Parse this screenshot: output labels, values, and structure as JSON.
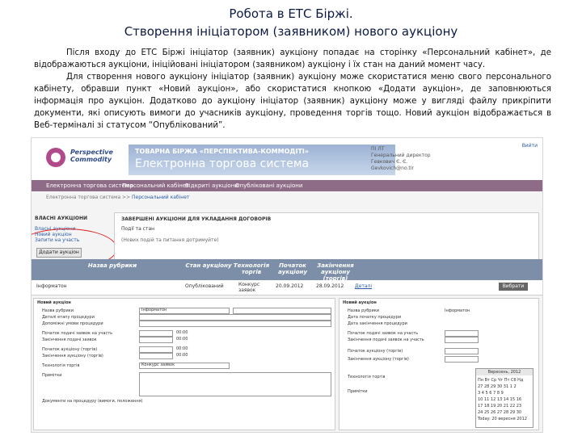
{
  "slide": {
    "title_line1": "Робота в ЕТС Біржі.",
    "title_line2": "Створення ініціатором (заявником) нового аукціону",
    "paragraph1": "Після входу до ЕТС Біржі ініціатор (заявник) аукціону попадає на сторінку «Персональний кабінет», де відображаються аукціони, ініційовані ініціатором (заявником) аукціону і їх стан на даний момент часу.",
    "paragraph2": "Для створення нового аукціону ініціатор (заявник) аукціону може скористатися меню свого персонального кабінету, обравши пункт «Новий аукціон», або скористатися кнопкою «Додати аукціон», де заповнюються інформація про аукціон. Додатково до аукціону ініціатор (заявник) аукціону може у вигляді файлу прикріпити документи, які описують вимоги до учасників аукціону, проведення торгів тощо. Новий аукціон відображається в Веб-терміналі зі статусом “Опублікований”."
  },
  "screenshot": {
    "logo_line1": "Perspective",
    "logo_line2": "Commodity",
    "banner_line1": "ТОВАРНА БІРЖА «ПЕРСПЕКТИВА-КОММОДІТІ»",
    "banner_line2": "Електронна торгова система",
    "user_line1": "ПІ      ЛТ",
    "user_line2": "Генеральний директор",
    "user_line3": "Гевкович Є. Є.",
    "user_line4": "Gevkovich@no.tir",
    "login": "Вийти",
    "nav": [
      "Електронна торгова система",
      "Персональний кабінет",
      "Відкриті аукціони",
      "Опубліковані аукціони"
    ],
    "crumb_a": "Електронна торгова система >> ",
    "crumb_b": "Персональний кабінет",
    "side_heading": "ВЛАСНІ АУКЦІОНИ",
    "side_items": [
      "Власні аукціони",
      "Новий аукціон",
      "Запити на участь"
    ],
    "add_button": "Додати аукціон",
    "panel_heading": "ЗАВЕРШЕНІ АУКЦІОНИ ДЛЯ УКЛАДАННЯ ДОГОВОРІВ",
    "panel_filter": "Події та стан",
    "panel_status": "(Нових подій та питання дотримуйте)",
    "table_headers": [
      "Назва рубрики",
      "Стан аукціону",
      "Технологія торгів",
      "Початок аукціону",
      "Закінчення аукціону (торгів)"
    ],
    "row": {
      "name": "Інформатон",
      "state": "Опублікований",
      "tech": "Конкурс заявок",
      "start": "20.09.2012",
      "end": "28.09.2012",
      "details": "Деталі",
      "view": "Вибрати"
    },
    "form_labels": [
      "Новий аукціон",
      "Назва рубрики",
      "Деталі етапу процедури",
      "Допоміжні умови процедури",
      "Початок подачі заявок на участь",
      "Закінчення подачі заявок",
      "Початок аукціону (торгів)",
      "Закінчення аукціону (торгів)",
      "Технологія торгів",
      "Примітки",
      "Документи на процедуру (вимоги, положення)"
    ],
    "form_value": "Інформатон",
    "form_tech": "Конкурс заявок",
    "time_value": "00:00",
    "right_labels": [
      "Новий аукціон",
      "Назва рубрики",
      "Дата початку процедури",
      "Дата закінчення процедури",
      "Початок подачі заявок на участь",
      "Закінчення подачі заявок на участь",
      "Початок аукціону (торгів)",
      "Закінчення аукціону (торгів)",
      "Технологія торгів",
      "Примітки"
    ],
    "right_value": "Інформатон",
    "calendar_title": "Вересень, 2012",
    "calendar_rows": [
      "Пн Вт Ср Чт Пт Сб Нд",
      "27 28 29 30 31 1 2",
      "3 4 5 6 7 8 9",
      "10 11 12 13 14 15 16",
      "17 18 19 20 21 22 23",
      "24 25 26 27 28 29 30"
    ],
    "calendar_footer": "Today: 20 вересня 2012"
  }
}
